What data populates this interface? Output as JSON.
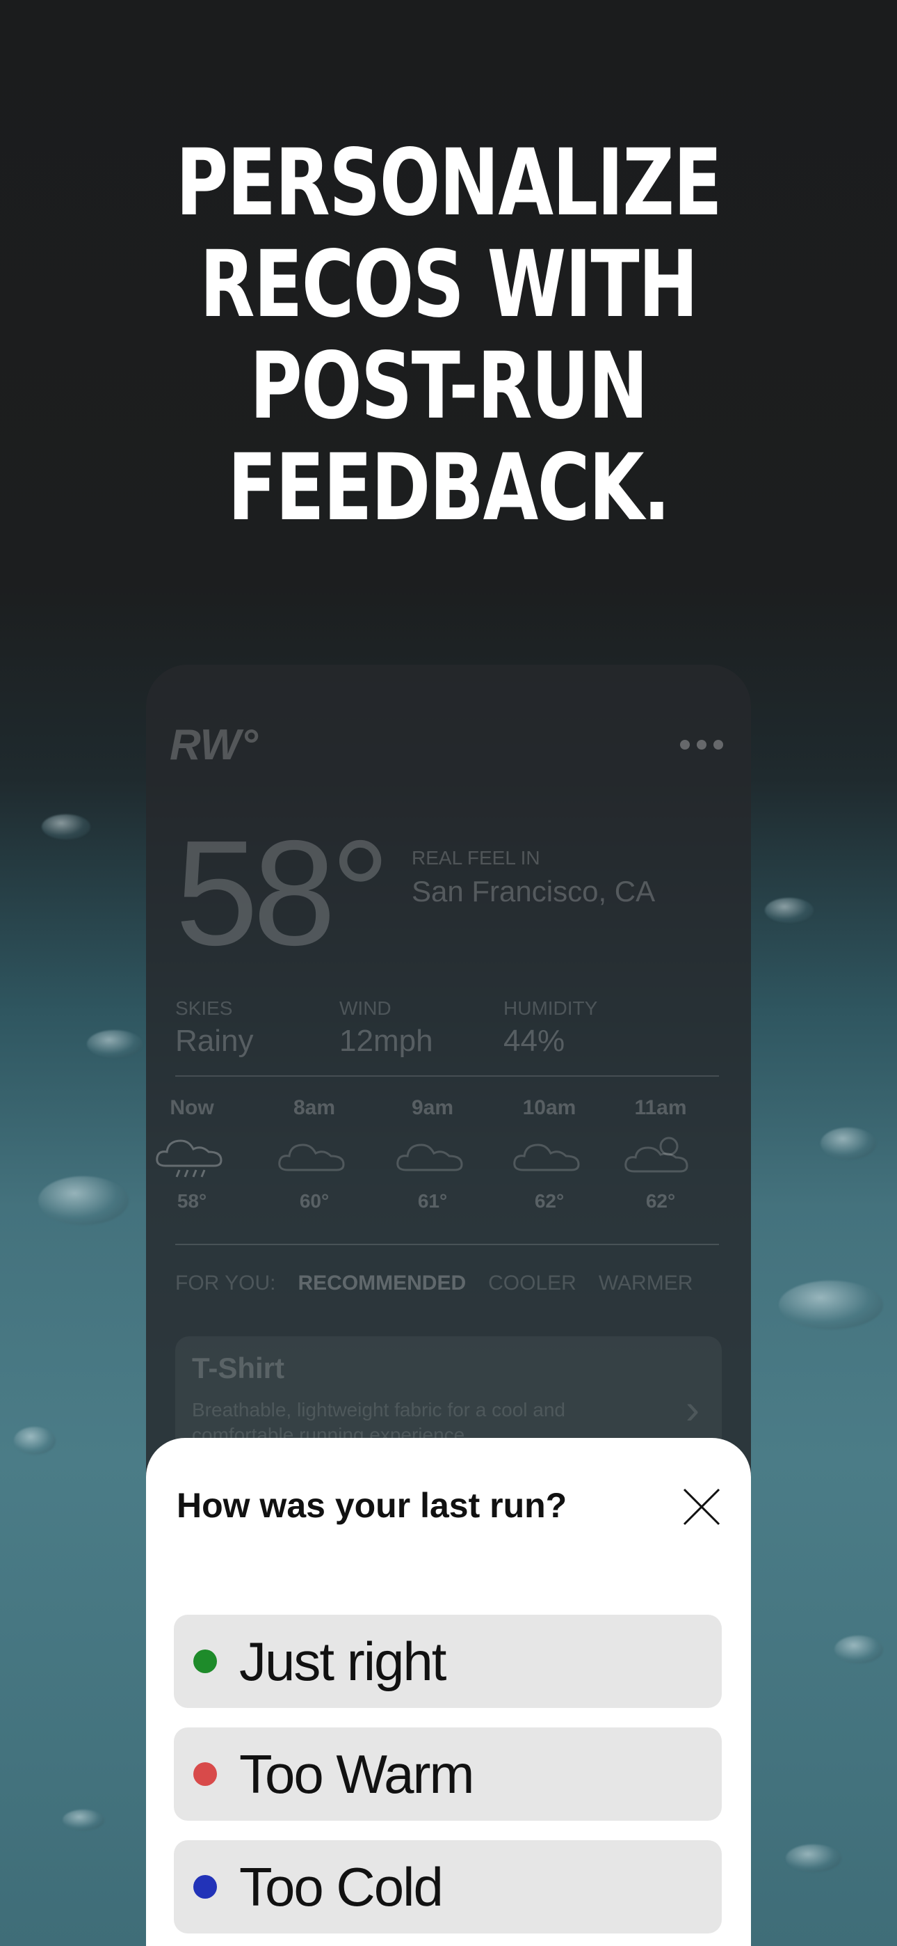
{
  "headline": [
    "PERSONALIZE",
    "RECOS WITH",
    "POST-RUN",
    "FEEDBACK."
  ],
  "app": {
    "logo": "RW°",
    "temperature": "58°",
    "real_feel_label": "REAL FEEL IN",
    "location": "San Francisco,  CA",
    "stats": [
      {
        "label": "SKIES",
        "value": "Rainy"
      },
      {
        "label": "WIND",
        "value": "12mph"
      },
      {
        "label": "HUMIDITY",
        "value": "44%"
      }
    ],
    "hourly": [
      {
        "time": "Now",
        "temp": "58°",
        "icon": "cloud-rain-icon"
      },
      {
        "time": "8am",
        "temp": "60°",
        "icon": "cloud-icon"
      },
      {
        "time": "9am",
        "temp": "61°",
        "icon": "cloud-icon"
      },
      {
        "time": "10am",
        "temp": "62°",
        "icon": "cloud-icon"
      },
      {
        "time": "11am",
        "temp": "62°",
        "icon": "cloud-sun-icon"
      }
    ],
    "for_you": {
      "label": "FOR YOU:",
      "tabs": [
        "RECOMMENDED",
        "COOLER",
        "WARMER"
      ]
    },
    "card": {
      "title": "T-Shirt",
      "description": "Breathable, lightweight fabric for a cool and comfortable running experience."
    }
  },
  "feedback": {
    "question": "How was your last run?",
    "options": [
      {
        "label": "Just right",
        "color": "#1e8b2a"
      },
      {
        "label": "Too Warm",
        "color": "#d84a4a"
      },
      {
        "label": "Too Cold",
        "color": "#2233b8"
      }
    ]
  }
}
